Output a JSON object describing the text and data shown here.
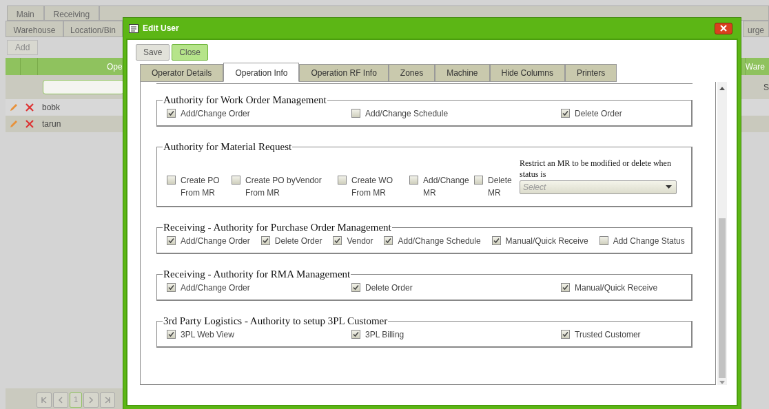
{
  "app": {
    "main_tabs": [
      {
        "label": "Main",
        "selected": false
      },
      {
        "label": "Receiving",
        "selected": false
      }
    ],
    "sub_tabs": [
      {
        "label": "Warehouse"
      },
      {
        "label": "Location/Bin"
      }
    ],
    "sub_tab_cut": "urge",
    "add_button": "Add",
    "grid": {
      "column_3": "Ope",
      "column_4": "Ware",
      "filter_cut": "S",
      "rows": [
        {
          "name": "bobk",
          "selected": false
        },
        {
          "name": "tarun",
          "selected": true
        }
      ]
    },
    "pager": {
      "page": "1"
    }
  },
  "dialog": {
    "title": "Edit User",
    "buttons": [
      "Save",
      "Close"
    ],
    "tabs": [
      {
        "label": "Operator Details",
        "selected": false
      },
      {
        "label": "Operation Info",
        "selected": true
      },
      {
        "label": "Operation RF Info",
        "selected": false
      },
      {
        "label": "Zones",
        "selected": false
      },
      {
        "label": "Machine",
        "selected": false
      },
      {
        "label": "Hide Columns",
        "selected": false
      },
      {
        "label": "Printers",
        "selected": false
      }
    ],
    "sections": [
      {
        "title": "Authority for Work Order Management",
        "kind": "spread",
        "items": [
          {
            "label": "Add/Change Order",
            "checked": true
          },
          {
            "label": "Add/Change Schedule",
            "checked": false
          },
          {
            "label": "Delete Order",
            "checked": true
          }
        ]
      },
      {
        "title": "Authority for Material Request",
        "kind": "wrap",
        "items": [
          {
            "label": "Create PO From MR",
            "checked": false
          },
          {
            "label": "Create PO byVendor From MR",
            "checked": false
          },
          {
            "label": "Create WO From MR",
            "checked": false
          },
          {
            "label": "Add/Change MR",
            "checked": false
          },
          {
            "label": "Delete MR",
            "checked": false
          }
        ],
        "restrict": {
          "label": "Restrict an MR to be modified or delete when status is",
          "placeholder": "Select"
        }
      },
      {
        "title": "Receiving - Authority for Purchase Order Management",
        "kind": "inline",
        "items": [
          {
            "label": "Add/Change Order",
            "checked": true
          },
          {
            "label": "Delete Order",
            "checked": true
          },
          {
            "label": "Vendor",
            "checked": true
          },
          {
            "label": "Add/Change Schedule",
            "checked": true
          },
          {
            "label": "Manual/Quick Receive",
            "checked": true
          },
          {
            "label": "Add Change Status",
            "checked": false
          }
        ]
      },
      {
        "title": "Receiving - Authority for RMA Management",
        "kind": "spread",
        "items": [
          {
            "label": "Add/Change Order",
            "checked": true
          },
          {
            "label": "Delete Order",
            "checked": true
          },
          {
            "label": "Manual/Quick Receive",
            "checked": true
          }
        ]
      },
      {
        "title": "3rd Party Logistics - Authority to setup 3PL Customer",
        "kind": "spread",
        "items": [
          {
            "label": "3PL Web View",
            "checked": true
          },
          {
            "label": "3PL Billing",
            "checked": true
          },
          {
            "label": "Trusted Customer",
            "checked": true
          }
        ]
      }
    ]
  }
}
